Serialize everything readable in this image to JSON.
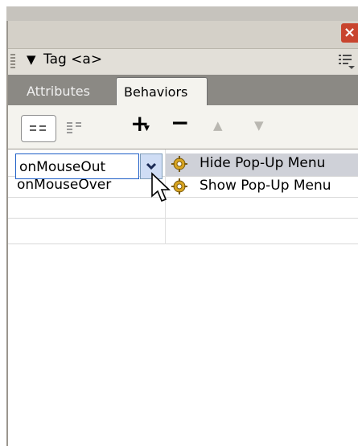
{
  "window": {
    "close_label": "×"
  },
  "panel": {
    "collapse_glyph": "▼",
    "title": "Tag <a>",
    "options_icon": "panel-options-icon"
  },
  "tabs": [
    {
      "label": "Attributes",
      "active": false
    },
    {
      "label": "Behaviors",
      "active": true
    }
  ],
  "toolbar": {
    "view_buttons": [
      "show-set-events-icon",
      "show-all-events-icon"
    ],
    "add_glyph": "+",
    "remove_glyph": "−",
    "move_up_glyph": "▲",
    "move_down_glyph": "▼"
  },
  "behaviors": [
    {
      "event": "onMouseOut",
      "action": "Hide Pop-Up Menu",
      "selected": true,
      "icon": "gear-icon"
    },
    {
      "event": "onMouseOver",
      "action": "Show Pop-Up Menu",
      "selected": false,
      "icon": "gear-icon"
    }
  ],
  "colors": {
    "tab_strip": "#8b8984",
    "selection": "#cfd1d8",
    "input_border": "#1d5ec7",
    "close_button": "#c8442e"
  }
}
